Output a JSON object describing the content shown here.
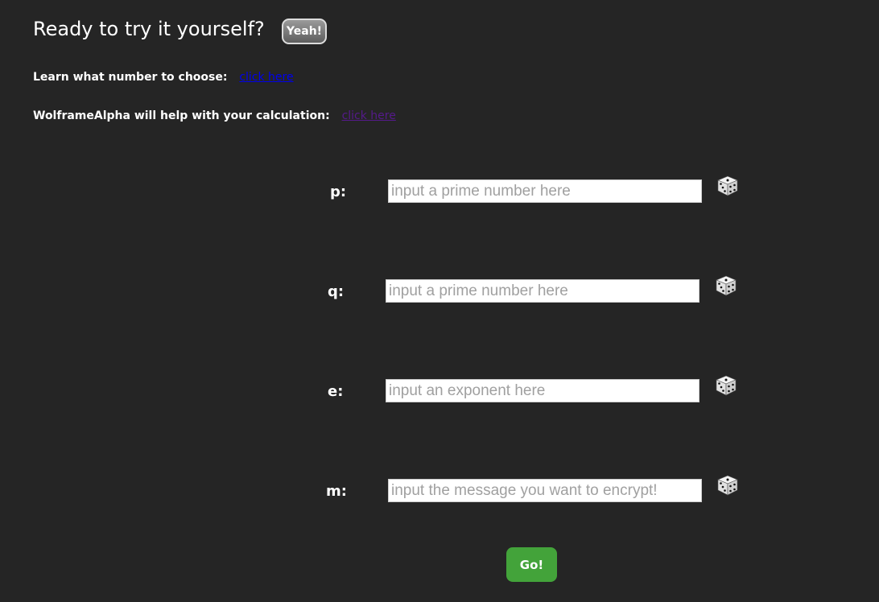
{
  "header": {
    "title": "Ready to try it yourself?",
    "yeah_label": "Yeah!"
  },
  "info": {
    "choose_label": "Learn what number to choose:",
    "choose_link": "click here",
    "wolfram_label": "WolframeAlpha will help with your calculation:",
    "wolfram_link": "click here"
  },
  "form": {
    "p": {
      "label": "p:",
      "placeholder": "input a prime number here"
    },
    "q": {
      "label": "q:",
      "placeholder": "input a prime number here"
    },
    "e": {
      "label": "e:",
      "placeholder": "input an exponent here"
    },
    "m": {
      "label": "m:",
      "placeholder": "input the message you want to encrypt!"
    },
    "go_label": "Go!"
  },
  "colors": {
    "background": "#252525",
    "go_button": "#43a33a",
    "link_unvisited": "#0000ee",
    "link_visited": "#551a8b"
  },
  "icons": {
    "randomize": "dice-icon"
  }
}
